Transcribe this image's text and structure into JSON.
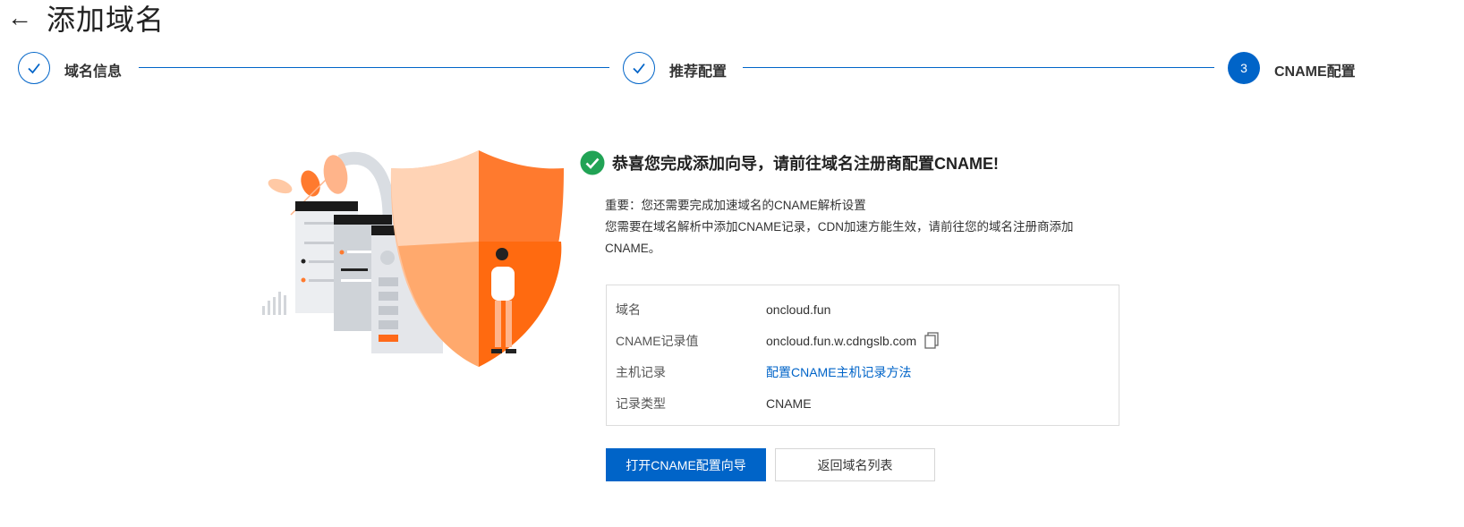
{
  "header": {
    "back_icon": "arrow-left-icon",
    "title": "添加域名"
  },
  "steps": [
    {
      "label": "域名信息",
      "status": "done",
      "icon": "check-icon"
    },
    {
      "label": "推荐配置",
      "status": "done",
      "icon": "check-icon"
    },
    {
      "label": "CNAME配置",
      "status": "active",
      "number": "3"
    }
  ],
  "success": {
    "icon": "success-check-icon",
    "title": "恭喜您完成添加向导，请前往域名注册商配置CNAME!"
  },
  "notes": {
    "line1": "重要：您还需要完成加速域名的CNAME解析设置",
    "line2": "您需要在域名解析中添加CNAME记录，CDN加速方能生效，请前往您的域名注册商添加CNAME。"
  },
  "info": {
    "rows": [
      {
        "label": "域名",
        "value": "oncloud.fun"
      },
      {
        "label": "CNAME记录值",
        "value": "oncloud.fun.w.cdngslb.com"
      },
      {
        "label": "主机记录",
        "value": "配置CNAME主机记录方法"
      },
      {
        "label": "记录类型",
        "value": "CNAME"
      }
    ]
  },
  "buttons": {
    "primary": "打开CNAME配置向导",
    "secondary": "返回域名列表"
  },
  "colors": {
    "primary": "#0064c8",
    "success": "#21a355",
    "accent_orange": "#ff7a2e"
  }
}
